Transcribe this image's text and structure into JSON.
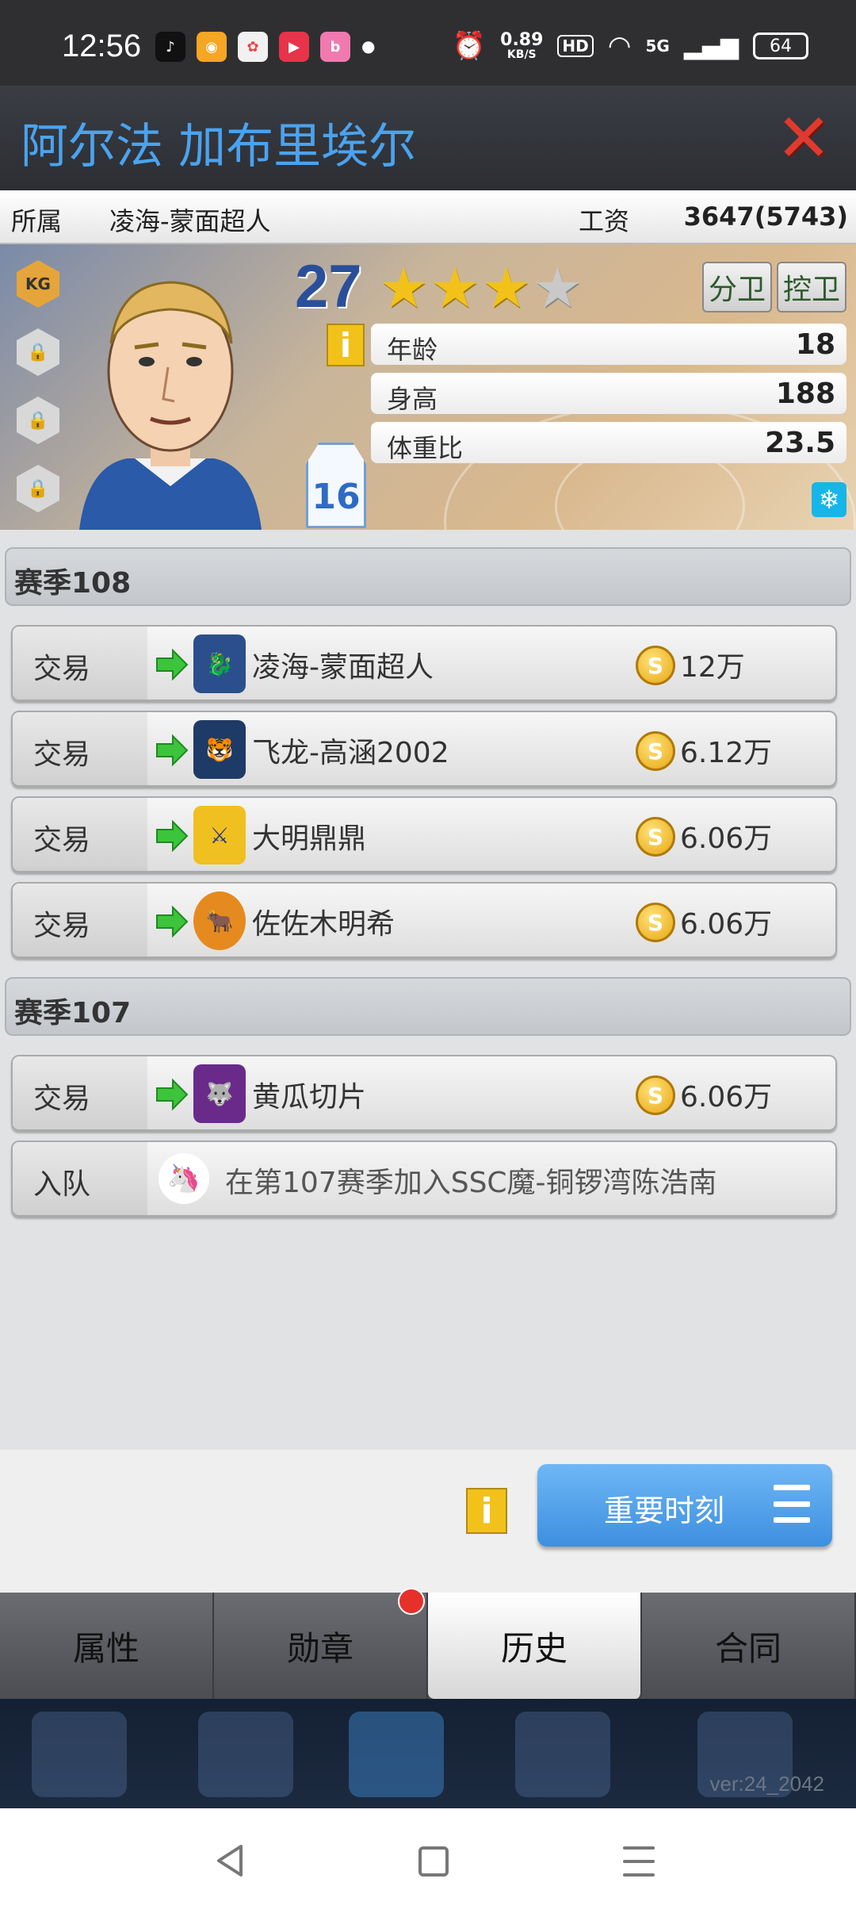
{
  "status_bar": {
    "time": "12:56",
    "net_speed_value": "0.89",
    "net_speed_unit": "KB/S",
    "hd": "HD",
    "signal": "5G",
    "battery": "64"
  },
  "header": {
    "player_name": "阿尔法 加布里埃尔",
    "close_icon": "close-icon"
  },
  "affiliation": {
    "label": "所属",
    "team": "凌海-蒙面超人",
    "salary_label": "工资",
    "salary_value": "3647(5743)"
  },
  "card": {
    "rating": "27",
    "stars_filled": 3,
    "stars_total": 5,
    "badge_kg": "KG",
    "positions": [
      "分卫",
      "控卫"
    ],
    "stats": [
      {
        "label": "年龄",
        "value": "18"
      },
      {
        "label": "身高",
        "value": "188"
      },
      {
        "label": "体重比",
        "value": "23.5"
      }
    ],
    "jersey_number": "16"
  },
  "history": {
    "seasons": [
      {
        "title": "赛季108",
        "entries": [
          {
            "type": "交易",
            "team": "凌海-蒙面超人",
            "price": "12万"
          },
          {
            "type": "交易",
            "team": "飞龙-高涵2002",
            "price": "6.12万"
          },
          {
            "type": "交易",
            "team": "大明鼎鼎",
            "price": "6.06万"
          },
          {
            "type": "交易",
            "team": "佐佐木明希",
            "price": "6.06万"
          }
        ]
      },
      {
        "title": "赛季107",
        "entries": [
          {
            "type": "交易",
            "team": "黄瓜切片",
            "price": "6.06万"
          }
        ],
        "join": {
          "type": "入队",
          "text": "在第107赛季加入SSC魔-铜锣湾陈浩南"
        }
      }
    ]
  },
  "actions": {
    "moment_button": "重要时刻"
  },
  "tabs": [
    "属性",
    "勋章",
    "历史",
    "合同"
  ],
  "active_tab": "历史",
  "version": "ver:24_2042",
  "colors": {
    "name_blue": "#4aa3f0",
    "close_red": "#e03a2e",
    "button_blue": "#3d8fe0",
    "coin_gold": "#e8a712"
  }
}
